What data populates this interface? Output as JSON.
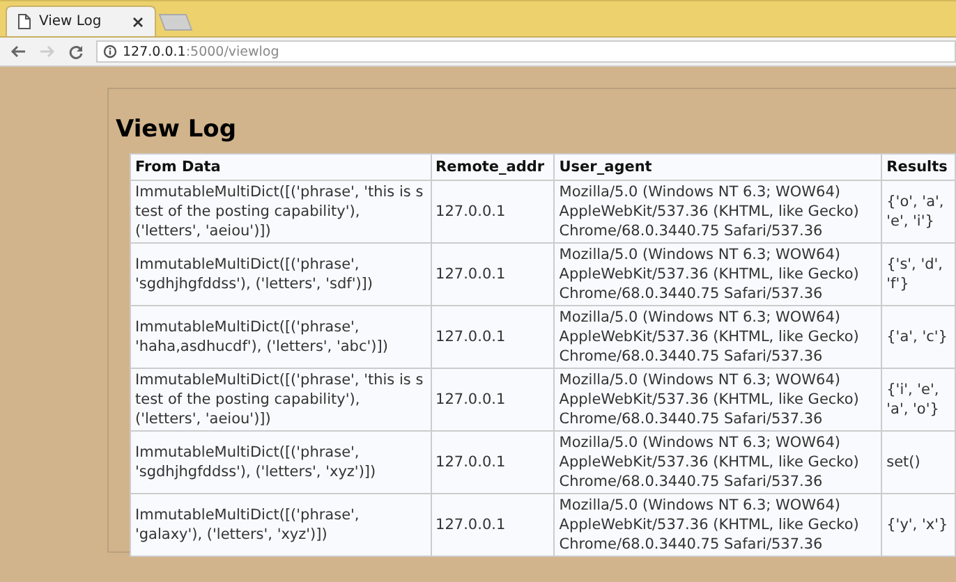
{
  "browser": {
    "tab_title": "View Log",
    "url_host": "127.0.0.1",
    "url_path": ":5000/viewlog"
  },
  "page": {
    "title": "View Log"
  },
  "table": {
    "columns": [
      "From Data",
      "Remote_addr",
      "User_agent",
      "Results"
    ],
    "rows": [
      [
        "ImmutableMultiDict([('phrase', 'this is s test of the posting capability'), ('letters', 'aeiou')])",
        "127.0.0.1",
        "Mozilla/5.0 (Windows NT 6.3; WOW64) AppleWebKit/537.36 (KHTML, like Gecko) Chrome/68.0.3440.75 Safari/537.36",
        "{'o', 'a', 'e', 'i'}"
      ],
      [
        "ImmutableMultiDict([('phrase', 'sgdhjhgfddss'), ('letters', 'sdf')])",
        "127.0.0.1",
        "Mozilla/5.0 (Windows NT 6.3; WOW64) AppleWebKit/537.36 (KHTML, like Gecko) Chrome/68.0.3440.75 Safari/537.36",
        "{'s', 'd', 'f'}"
      ],
      [
        "ImmutableMultiDict([('phrase', 'haha,asdhucdf'), ('letters', 'abc')])",
        "127.0.0.1",
        "Mozilla/5.0 (Windows NT 6.3; WOW64) AppleWebKit/537.36 (KHTML, like Gecko) Chrome/68.0.3440.75 Safari/537.36",
        "{'a', 'c'}"
      ],
      [
        "ImmutableMultiDict([('phrase', 'this is s test of the posting capability'), ('letters', 'aeiou')])",
        "127.0.0.1",
        "Mozilla/5.0 (Windows NT 6.3; WOW64) AppleWebKit/537.36 (KHTML, like Gecko) Chrome/68.0.3440.75 Safari/537.36",
        "{'i', 'e', 'a', 'o'}"
      ],
      [
        "ImmutableMultiDict([('phrase', 'sgdhjhgfddss'), ('letters', 'xyz')])",
        "127.0.0.1",
        "Mozilla/5.0 (Windows NT 6.3; WOW64) AppleWebKit/537.36 (KHTML, like Gecko) Chrome/68.0.3440.75 Safari/537.36",
        "set()"
      ],
      [
        "ImmutableMultiDict([('phrase', 'galaxy'), ('letters', 'xyz')])",
        "127.0.0.1",
        "Mozilla/5.0 (Windows NT 6.3; WOW64) AppleWebKit/537.36 (KHTML, like Gecko) Chrome/68.0.3440.75 Safari/537.36",
        "{'y', 'x'}"
      ]
    ]
  }
}
